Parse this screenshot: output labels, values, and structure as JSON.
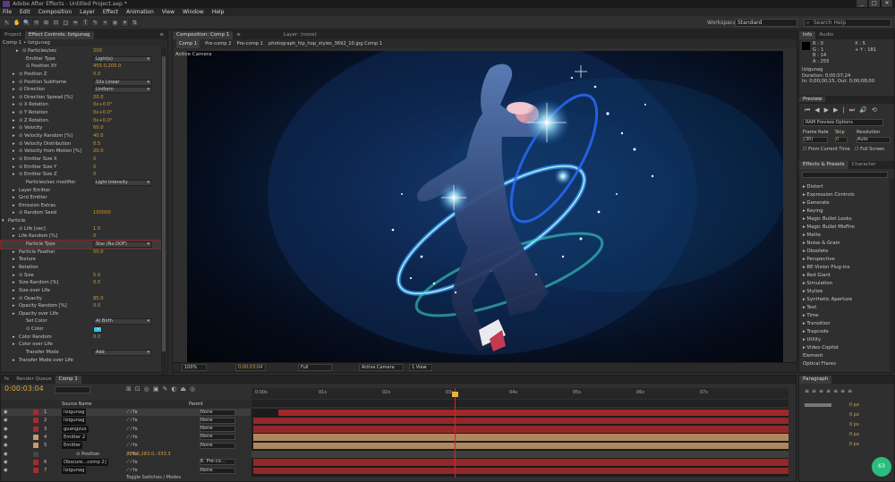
{
  "app": {
    "title": "Adobe After Effects - Untitled Project.aep *",
    "window_buttons": [
      "_",
      "□",
      "✕"
    ]
  },
  "menu": [
    "File",
    "Edit",
    "Composition",
    "Layer",
    "Effect",
    "Animation",
    "View",
    "Window",
    "Help"
  ],
  "toolbar": {
    "workspace_label": "Workspace:",
    "workspace_value": "Standard",
    "search_placeholder": "Search Help",
    "tools": [
      "↖",
      "✋",
      "🔍",
      "⟲",
      "⊞",
      "⊡",
      "□",
      "✒",
      "T",
      "✎",
      "⌖",
      "◈",
      "✦",
      "⇅"
    ]
  },
  "left_panel": {
    "tabs": [
      "Project",
      "Effect Controls: lizigunag",
      "≡"
    ],
    "header": "Comp 1 • lizigunag",
    "rows": [
      {
        "label": "⊙ Particles/sec",
        "value": "200",
        "indent": 24,
        "arrow": "▸",
        "type": "val"
      },
      {
        "label": "Emitter Type",
        "value": "Light(s)",
        "indent": 28,
        "type": "dd"
      },
      {
        "label": "⊙ Position XY",
        "value": "455.0,205.0",
        "indent": 28,
        "type": "val"
      },
      {
        "label": "⊙ Position Z",
        "value": "0.0",
        "indent": 20,
        "arrow": "▸",
        "type": "val"
      },
      {
        "label": "⊙ Position Subframe",
        "value": "10x Linear",
        "indent": 20,
        "arrow": "▸",
        "type": "dd"
      },
      {
        "label": "⊙ Direction",
        "value": "Uniform",
        "indent": 20,
        "arrow": "▸",
        "type": "dd"
      },
      {
        "label": "⊙ Direction Spread [%]",
        "value": "20.0",
        "indent": 20,
        "arrow": "▸",
        "type": "val"
      },
      {
        "label": "⊙ X Rotation",
        "value": "0x+0.0°",
        "indent": 20,
        "arrow": "▸",
        "type": "val"
      },
      {
        "label": "⊙ Y Rotation",
        "value": "0x+0.0°",
        "indent": 20,
        "arrow": "▸",
        "type": "val"
      },
      {
        "label": "⊙ Z Rotation",
        "value": "0x+0.0°",
        "indent": 20,
        "arrow": "▸",
        "type": "val"
      },
      {
        "label": "⊙ Velocity",
        "value": "60.0",
        "indent": 20,
        "arrow": "▸",
        "type": "val"
      },
      {
        "label": "⊙ Velocity Random [%]",
        "value": "40.0",
        "indent": 20,
        "arrow": "▸",
        "type": "val"
      },
      {
        "label": "⊙ Velocity Distribution",
        "value": "0.5",
        "indent": 20,
        "arrow": "▸",
        "type": "val"
      },
      {
        "label": "⊙ Velocity from Motion [%]",
        "value": "20.0",
        "indent": 20,
        "arrow": "▸",
        "type": "val"
      },
      {
        "label": "⊙ Emitter Size X",
        "value": "0",
        "indent": 20,
        "arrow": "▸",
        "type": "val"
      },
      {
        "label": "⊙ Emitter Size Y",
        "value": "0",
        "indent": 20,
        "arrow": "▸",
        "type": "val"
      },
      {
        "label": "⊙ Emitter Size Z",
        "value": "0",
        "indent": 20,
        "arrow": "▸",
        "type": "val"
      },
      {
        "label": "Particles/sec modifier",
        "value": "Light Intensity",
        "indent": 28,
        "type": "dd"
      },
      {
        "label": "Layer Emitter",
        "value": "",
        "indent": 20,
        "arrow": "▸",
        "type": "none"
      },
      {
        "label": "Grid Emitter",
        "value": "",
        "indent": 20,
        "arrow": "▸",
        "type": "none"
      },
      {
        "label": "Emission Extras",
        "value": "",
        "indent": 20,
        "arrow": "▸",
        "type": "none"
      },
      {
        "label": "⊙ Random Seed",
        "value": "100000",
        "indent": 20,
        "arrow": "▸",
        "type": "val"
      },
      {
        "label": "Particle",
        "value": "",
        "indent": 8,
        "arrow": "▾",
        "type": "none"
      },
      {
        "label": "⊙ Life [sec]",
        "value": "1.0",
        "indent": 20,
        "arrow": "▸",
        "type": "val"
      },
      {
        "label": "Life Random [%]",
        "value": "0",
        "indent": 20,
        "arrow": "▸",
        "type": "val"
      },
      {
        "label": "Particle Type",
        "value": "Star (No DOF)",
        "indent": 28,
        "type": "dd",
        "selected": true
      },
      {
        "label": "Particle Feather",
        "value": "50.0",
        "indent": 20,
        "arrow": "▸",
        "type": "val"
      },
      {
        "label": "Texture",
        "value": "",
        "indent": 20,
        "arrow": "▸",
        "type": "none"
      },
      {
        "label": "Rotation",
        "value": "",
        "indent": 20,
        "arrow": "▸",
        "type": "none"
      },
      {
        "label": "⊙ Size",
        "value": "5.0",
        "indent": 20,
        "arrow": "▸",
        "type": "val"
      },
      {
        "label": "Size Random [%]",
        "value": "0.0",
        "indent": 20,
        "arrow": "▸",
        "type": "val"
      },
      {
        "label": "Size over Life",
        "value": "",
        "indent": 20,
        "arrow": "▸",
        "type": "none"
      },
      {
        "label": "⊙ Opacity",
        "value": "85.0",
        "indent": 20,
        "arrow": "▸",
        "type": "val"
      },
      {
        "label": "Opacity Random [%]",
        "value": "0.0",
        "indent": 20,
        "arrow": "▸",
        "type": "val"
      },
      {
        "label": "Opacity over Life",
        "value": "",
        "indent": 20,
        "arrow": "▸",
        "type": "none"
      },
      {
        "label": "Set Color",
        "value": "At Birth",
        "indent": 28,
        "type": "dd"
      },
      {
        "label": "⊙ Color",
        "value": "",
        "indent": 28,
        "type": "color"
      },
      {
        "label": "Color Random",
        "value": "0.0",
        "indent": 20,
        "arrow": "▸",
        "type": "val"
      },
      {
        "label": "Color over Life",
        "value": "",
        "indent": 20,
        "arrow": "▸",
        "type": "none"
      },
      {
        "label": "Transfer Mode",
        "value": "Add",
        "indent": 28,
        "type": "dd"
      },
      {
        "label": "Transfer Mode over Life",
        "value": "",
        "indent": 20,
        "arrow": "▸",
        "type": "none"
      }
    ]
  },
  "viewer": {
    "tabs": [
      "Composition: Comp 1",
      "≡",
      "Layer: (none)"
    ],
    "breadcrumbs": [
      "Comp 1",
      "Pre-comp 2",
      "Pre-comp 1",
      "photograph_hip_hop_styles_3692_10.jpg Comp 1"
    ],
    "camera_label": "Active Camera",
    "bottom": {
      "zoom": "100%",
      "timecode": "0:00:03:04",
      "resolution": "Full",
      "camera": "Active Camera",
      "views": "1 View"
    }
  },
  "info_panel": {
    "tabs": [
      "Info",
      "Audio"
    ],
    "r": "R : 0",
    "g": "G : 1",
    "b": "B : 14",
    "a": "A : 255",
    "x": "X : 5",
    "y": "+ Y : 181",
    "layer_name": "lizigunag",
    "duration": "Duration: 0;00;07;24",
    "inout": "In: 0;00;00;15,  Out: 0;00;08;00"
  },
  "preview_panel": {
    "tab": "Preview",
    "ram_option": "RAM Preview Options",
    "frame_rate_label": "Frame Rate",
    "skip_label": "Skip",
    "resolution_label": "Resolution",
    "frame_rate_value": "(30)",
    "skip_value": "0",
    "resolution_value": "Auto",
    "from_current": "From Current Time",
    "full_screen": "Full Screen"
  },
  "effects_panel": {
    "tabs": [
      "Effects & Presets",
      "Character"
    ],
    "items": [
      "Distort",
      "Expression Controls",
      "Generate",
      "Keying",
      "Magic Bullet Looks",
      "Magic Bullet MisFire",
      "Matte",
      "Noise & Grain",
      "Obsolete",
      "Perspective",
      "RE:Vision Plug-ins",
      "Red Giant",
      "Simulation",
      "Stylize",
      "Synthetic Aperture",
      "Text",
      "Time",
      "Transition",
      "Trapcode",
      "Utility",
      "Video Copilot",
      "Element",
      "Optical Flares"
    ]
  },
  "timeline": {
    "tabs": [
      "fx",
      "Render Queue",
      "Comp 1"
    ],
    "timecode": "0:00:03:04",
    "columns": {
      "source": "Source Name",
      "parent": "Parent"
    },
    "ruler": [
      "0:00s",
      "01s",
      "02s",
      "03s",
      "04s",
      "05s",
      "06s",
      "07s"
    ],
    "layers": [
      {
        "num": "1",
        "name": "lizigunag",
        "parent": "None",
        "color": "#a8292b",
        "selected": true
      },
      {
        "num": "2",
        "name": "lizigunag",
        "parent": "None",
        "color": "#a8292b"
      },
      {
        "num": "3",
        "name": "guangzuo",
        "parent": "None",
        "color": "#a8292b"
      },
      {
        "num": "4",
        "name": "Emitter 2",
        "parent": "None",
        "color": "#c79b6a"
      },
      {
        "num": "5",
        "name": "Emitter",
        "parent": "None",
        "color": "#c79b6a"
      },
      {
        "num": "",
        "name": "⊙ Position",
        "parent": "309.0,283.0,-333.3",
        "color": "#444444",
        "sub": true
      },
      {
        "num": "6",
        "name": "Obscure...comp 2]",
        "parent": "6. Pre-co...",
        "color": "#a8292b"
      },
      {
        "num": "7",
        "name": "lizigunag",
        "parent": "None",
        "color": "#a8292b"
      }
    ],
    "footer": "Toggle Switches / Modes"
  },
  "paragraph_panel": {
    "tab": "Paragraph",
    "values": [
      "0 px",
      "0 px",
      "0 px",
      "0 px",
      "0 px"
    ]
  },
  "badge": "63"
}
